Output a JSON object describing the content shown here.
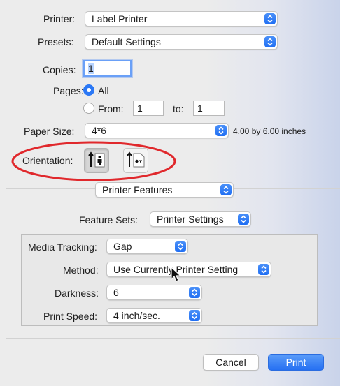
{
  "printer": {
    "label": "Printer:",
    "value": "Label Printer"
  },
  "presets": {
    "label": "Presets:",
    "value": "Default Settings"
  },
  "copies": {
    "label": "Copies:",
    "value": "1"
  },
  "pages": {
    "label": "Pages:",
    "all_label": "All",
    "from_label": "From:",
    "from_value": "1",
    "to_label": "to:",
    "to_value": "1"
  },
  "paper_size": {
    "label": "Paper Size:",
    "value": "4*6",
    "dimensions": "4.00 by 6.00 inches"
  },
  "orientation": {
    "label": "Orientation:",
    "portrait_icon": "portrait-orientation-icon",
    "landscape_icon": "landscape-orientation-icon"
  },
  "section": {
    "value": "Printer Features"
  },
  "feature_sets": {
    "label": "Feature Sets:",
    "value": "Printer Settings"
  },
  "features": {
    "media_tracking": {
      "label": "Media Tracking:",
      "value": "Gap"
    },
    "method": {
      "label": "Method:",
      "value": "Use Currently Printer Setting"
    },
    "darkness": {
      "label": "Darkness:",
      "value": "6"
    },
    "print_speed": {
      "label": "Print Speed:",
      "value": "4 inch/sec."
    }
  },
  "buttons": {
    "cancel": "Cancel",
    "print": "Print"
  },
  "colors": {
    "accent": "#2b78f5",
    "annotation": "#e0282c"
  }
}
